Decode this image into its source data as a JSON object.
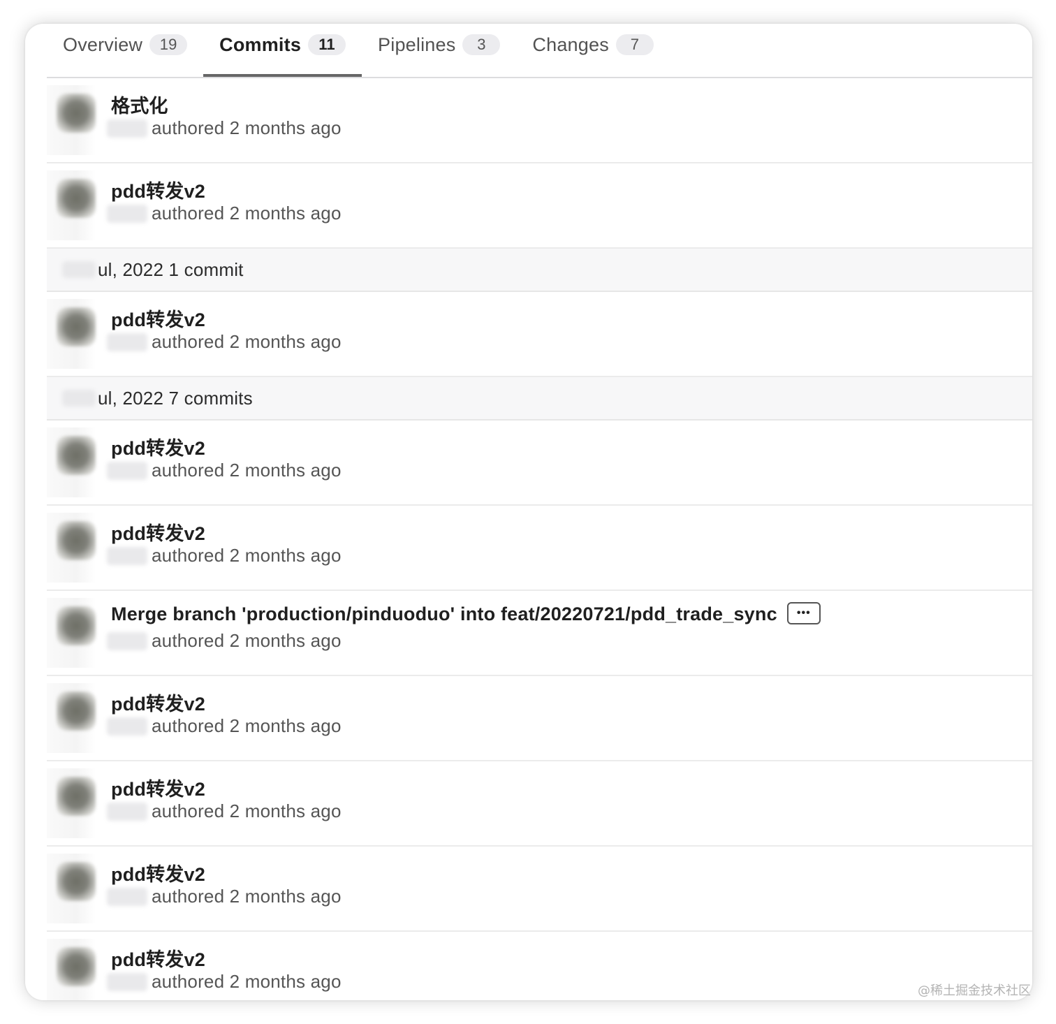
{
  "tabs": [
    {
      "label": "Overview",
      "count": "19"
    },
    {
      "label": "Commits",
      "count": "11",
      "active": true
    },
    {
      "label": "Pipelines",
      "count": "3"
    },
    {
      "label": "Changes",
      "count": "7"
    }
  ],
  "list": [
    {
      "type": "commit",
      "title": "格式化",
      "meta": "authored 2 months ago"
    },
    {
      "type": "commit",
      "title": "pdd转发v2",
      "meta": "authored 2 months ago"
    },
    {
      "type": "date",
      "text": "ul, 2022 1 commit"
    },
    {
      "type": "commit",
      "title": "pdd转发v2",
      "meta": "authored 2 months ago"
    },
    {
      "type": "date",
      "text": "ul, 2022 7 commits"
    },
    {
      "type": "commit",
      "title": "pdd转发v2",
      "meta": "authored 2 months ago"
    },
    {
      "type": "commit",
      "title": "pdd转发v2",
      "meta": "authored 2 months ago"
    },
    {
      "type": "commit",
      "title": "Merge branch 'production/pinduoduo' into feat/20220721/pdd_trade_sync",
      "meta": "authored 2 months ago",
      "more": "•••"
    },
    {
      "type": "commit",
      "title": "pdd转发v2",
      "meta": "authored 2 months ago"
    },
    {
      "type": "commit",
      "title": "pdd转发v2",
      "meta": "authored 2 months ago"
    },
    {
      "type": "commit",
      "title": "pdd转发v2",
      "meta": "authored 2 months ago"
    },
    {
      "type": "commit",
      "title": "pdd转发v2",
      "meta": "authored 2 months ago"
    }
  ],
  "watermark": "@稀土掘金技术社区"
}
